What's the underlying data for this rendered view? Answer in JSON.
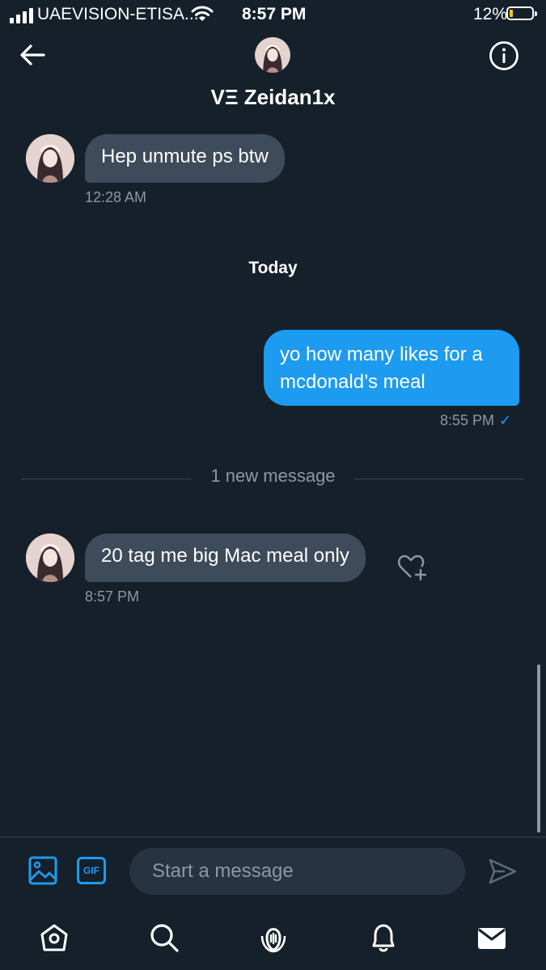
{
  "status_bar": {
    "carrier": "UAEVISION-ETISA...",
    "time": "8:57 PM",
    "battery": "12%",
    "battery_level": 0.12
  },
  "header": {
    "title": "VΞ Zeidan1x"
  },
  "messages": [
    {
      "text": "Hep unmute ps btw",
      "time": "12:28 AM",
      "direction": "incoming"
    },
    {
      "text": "yo how many likes for a mcdonald’s meal",
      "time": "8:55 PM",
      "read_mark": "✓",
      "direction": "outgoing"
    },
    {
      "text": "20 tag me big Mac meal only",
      "time": "8:57 PM",
      "direction": "incoming"
    }
  ],
  "date_separator": "Today",
  "new_message_divider": "1 new message",
  "composer": {
    "placeholder": "Start a message",
    "gif_label": "GIF"
  },
  "icons": {
    "back": "arrow-left-icon",
    "info": "info-icon",
    "image": "image-icon",
    "send": "send-icon",
    "react": "heart-plus-icon",
    "tabs": [
      "home-icon",
      "search-icon",
      "spaces-icon",
      "notifications-icon",
      "messages-icon"
    ]
  },
  "colors": {
    "background": "#15202b",
    "incoming_bubble": "#3d4b5a",
    "outgoing_bubble": "#1d9bf0",
    "secondary_text": "#8b98a5"
  }
}
